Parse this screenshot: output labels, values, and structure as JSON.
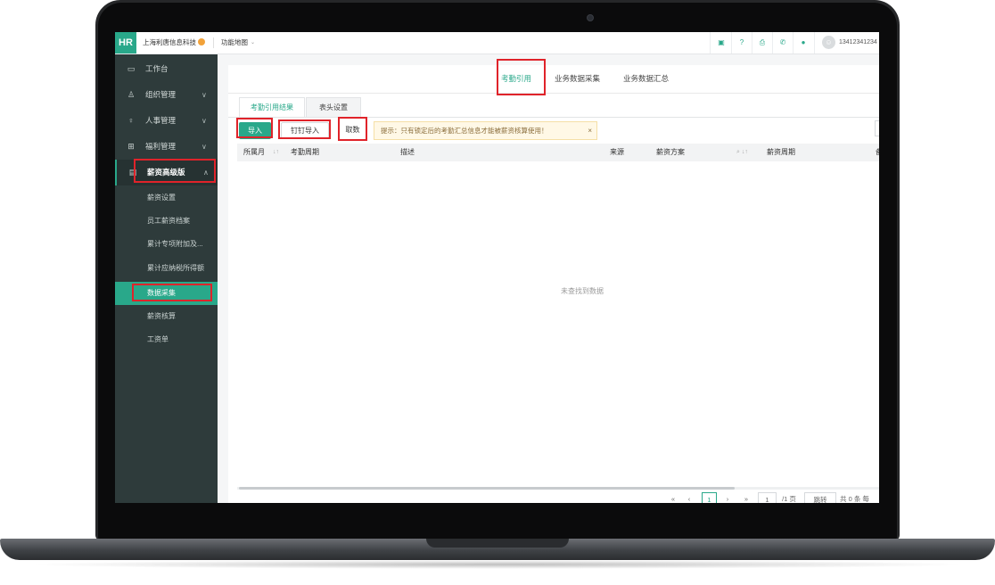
{
  "topbar": {
    "logo": "HR",
    "company": "上海利唐信息科技",
    "function_map": "功能地图",
    "chevron": "⌄",
    "phone": "13412341234",
    "icons": [
      "save-icon",
      "help-icon",
      "print-icon",
      "phone-icon",
      "bell-icon"
    ]
  },
  "sidebar": {
    "items": [
      {
        "icon": "monitor-icon",
        "label": "工作台"
      },
      {
        "icon": "org-icon",
        "label": "组织管理"
      },
      {
        "icon": "person-icon",
        "label": "人事管理"
      },
      {
        "icon": "gift-icon",
        "label": "福利管理"
      },
      {
        "icon": "wallet-icon",
        "label": "薪资高级版"
      }
    ],
    "sub_items": [
      "薪资设置",
      "员工薪资档案",
      "累计专项附加及...",
      "累计应纳税所得额",
      "数据采集",
      "薪资核算",
      "工资单"
    ]
  },
  "main": {
    "tabs": [
      "考勤引用",
      "业务数据采集",
      "业务数据汇总"
    ],
    "subtabs": [
      "考勤引用结果",
      "表头设置"
    ],
    "buttons": {
      "import": "导入",
      "dingding_import": "钉钉导入",
      "fetch": "取数"
    },
    "hint": "提示：只有锁定后的考勤汇总信息才能被薪资核算使用！",
    "hint_close": "×",
    "columns": [
      "所属月",
      "考勤周期",
      "描述",
      "来源",
      "薪资方案",
      "薪资周期",
      "备"
    ],
    "empty_text": "未查找到数据",
    "pagination": {
      "first": "«",
      "prev": "‹",
      "current": "1",
      "next": "›",
      "last": "»",
      "goto_value": "1",
      "total_pages": "/1 页",
      "jump": "跳转",
      "total": "共 0 条 每"
    }
  },
  "colors": {
    "accent": "#29a88a",
    "sidebar_bg": "#2e3b3b",
    "annotation": "#e0232a"
  }
}
